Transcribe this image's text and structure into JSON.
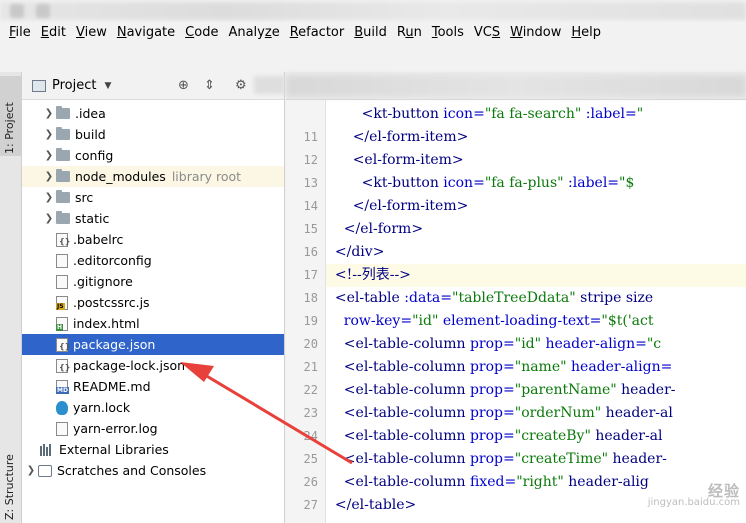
{
  "menu": [
    "File",
    "Edit",
    "View",
    "Navigate",
    "Code",
    "Analyze",
    "Refactor",
    "Build",
    "Run",
    "Tools",
    "VCS",
    "Window",
    "Help"
  ],
  "mnemonics": [
    "F",
    "E",
    "V",
    "N",
    "C",
    "z",
    "R",
    "B",
    "u",
    "T",
    "S",
    "W",
    "H"
  ],
  "side_tabs": {
    "project": "1: Project",
    "structure": "Z: Structure"
  },
  "project_panel": {
    "title": "Project",
    "tree": [
      {
        "label": ".idea",
        "kind": "folder",
        "expandable": true
      },
      {
        "label": "build",
        "kind": "folder",
        "expandable": true
      },
      {
        "label": "config",
        "kind": "folder",
        "expandable": true
      },
      {
        "label": "node_modules",
        "kind": "folder",
        "expandable": true,
        "suffix": "library root",
        "highlight": true
      },
      {
        "label": "src",
        "kind": "folder",
        "expandable": true
      },
      {
        "label": "static",
        "kind": "folder",
        "expandable": true
      },
      {
        "label": ".babelrc",
        "kind": "json"
      },
      {
        "label": ".editorconfig",
        "kind": "file"
      },
      {
        "label": ".gitignore",
        "kind": "file"
      },
      {
        "label": ".postcssrc.js",
        "kind": "js"
      },
      {
        "label": "index.html",
        "kind": "html"
      },
      {
        "label": "package.json",
        "kind": "json",
        "selected": true
      },
      {
        "label": "package-lock.json",
        "kind": "json"
      },
      {
        "label": "README.md",
        "kind": "md"
      },
      {
        "label": "yarn.lock",
        "kind": "yarn"
      },
      {
        "label": "yarn-error.log",
        "kind": "file"
      },
      {
        "label": "External Libraries",
        "kind": "library",
        "top": true
      },
      {
        "label": "Scratches and Consoles",
        "kind": "scratch",
        "top": true,
        "expandable": true
      }
    ]
  },
  "editor": {
    "lines": [
      {
        "num": "",
        "text": "        <kt-button icon=\"fa fa-search\" :label=\""
      },
      {
        "num": "11",
        "text": "      </el-form-item>"
      },
      {
        "num": "12",
        "text": "      <el-form-item>"
      },
      {
        "num": "13",
        "text": "        <kt-button icon=\"fa fa-plus\" :label=\"$"
      },
      {
        "num": "14",
        "text": "      </el-form-item>"
      },
      {
        "num": "15",
        "text": "    </el-form>"
      },
      {
        "num": "16",
        "text": "  </div>"
      },
      {
        "num": "17",
        "text": "  <!--列表-->",
        "current": true
      },
      {
        "num": "18",
        "text": "  <el-table :data=\"tableTreeDdata\" stripe size"
      },
      {
        "num": "19",
        "text": "    row-key=\"id\" element-loading-text=\"$t('act"
      },
      {
        "num": "20",
        "text": "    <el-table-column prop=\"id\" header-align=\"c"
      },
      {
        "num": "21",
        "text": "    <el-table-column prop=\"name\" header-align="
      },
      {
        "num": "22",
        "text": "    <el-table-column prop=\"parentName\" header-"
      },
      {
        "num": "23",
        "text": "    <el-table-column prop=\"orderNum\" header-al"
      },
      {
        "num": "24",
        "text": "    <el-table-column prop=\"createBy\" header-al"
      },
      {
        "num": "25",
        "text": "    <el-table-column prop=\"createTime\" header-"
      },
      {
        "num": "26",
        "text": "    <el-table-column fixed=\"right\" header-alig"
      },
      {
        "num": "27",
        "text": "  </el-table>"
      }
    ]
  },
  "colors": {
    "selection": "#2f65ca",
    "annotation_arrow": "#e8403a"
  },
  "watermark": {
    "line1": "经验",
    "line2": "jingyan.baidu.com"
  }
}
